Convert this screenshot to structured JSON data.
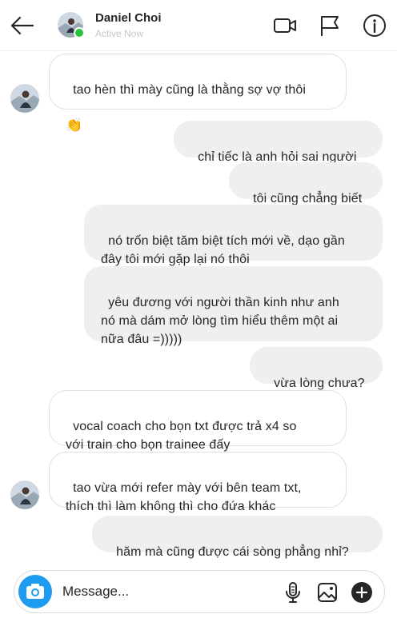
{
  "header": {
    "name": "Daniel Choi",
    "status": "Active Now"
  },
  "messages": [
    {
      "side": "in",
      "text": "tao hèn thì mày cũng là thằng sợ vợ thôi",
      "emoji": "👏"
    },
    {
      "side": "out",
      "text": "chỉ tiếc là anh hỏi sai người"
    },
    {
      "side": "out",
      "text": "tôi cũng chẳng biết"
    },
    {
      "side": "out",
      "text": "nó trốn biệt tăm biệt tích mới về, dạo gần\nđây tôi mới gặp lại nó thôi"
    },
    {
      "side": "out",
      "text": "yêu đương với người thần kinh như anh\nnó mà dám mở lòng tìm hiểu thêm một ai\nnữa đâu =)))))"
    },
    {
      "side": "out",
      "text": "vừa lòng chưa?"
    },
    {
      "side": "in",
      "text": "vocal coach cho bọn txt được trả x4 so\nvới train cho bọn trainee đấy"
    },
    {
      "side": "in",
      "text": "tao vừa mới refer mày với bên team txt,\nthích thì làm không thì cho đứa khác"
    },
    {
      "side": "out",
      "text": "hăm mà cũng được cái sòng phẳng nhỉ?"
    }
  ],
  "composer": {
    "placeholder": "Message..."
  },
  "icons": {
    "back": "back-arrow-icon",
    "video": "video-call-icon",
    "report": "flag-icon",
    "info": "info-icon",
    "camera": "camera-icon",
    "mic": "microphone-icon",
    "gallery": "image-icon",
    "more": "plus-circle-icon"
  },
  "colors": {
    "accent": "#1d9bf0",
    "online": "#26c43b",
    "outgoing_bubble": "#efefef",
    "incoming_border": "#dfdfdf"
  }
}
